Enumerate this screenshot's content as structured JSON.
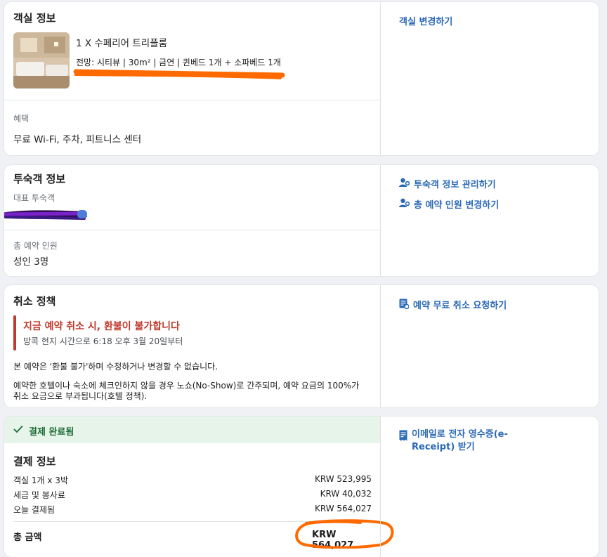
{
  "room": {
    "title": "객실 정보",
    "room_name": "1 X 수페리어 트리플룸",
    "details": "전망: 시티뷰 | 30m² | 금연 | 퀸베드 1개 + 소파베드 1개",
    "benefits_label": "혜택",
    "benefits_value": "무료 Wi-Fi, 주차, 피트니스 센터",
    "change_link": "객실 변경하기"
  },
  "guest": {
    "title": "투숙객 정보",
    "main_guest_label": "대표 투숙객",
    "total_label": "총 예약 인원",
    "total_value": "성인 3명",
    "manage_link": "투숙객 정보 관리하기",
    "change_count_link": "총 예약 인원 변경하기"
  },
  "cancel": {
    "title": "취소 정책",
    "warning": "지금 예약 취소 시, 환불이 불가합니다",
    "since": "방콕 현지 시간으로 6:18 오후 3월 20일부터",
    "note1": "본 예약은 '환불 불가'하며 수정하거나 변경할 수 없습니다.",
    "note2_line1": "예약한 호텔이나 숙소에 체크인하지 않을 경우 노쇼(No-Show)로 간주되며, 예약 요금의 100%가",
    "note2_line2": "취소 요금으로 부과됩니다(호텔 정책).",
    "request_link": "예약 무료 취소 요청하기"
  },
  "payment": {
    "status": "결제 완료됨",
    "title": "결제 정보",
    "rows": [
      {
        "label": "객실 1개 x 3박",
        "value": "KRW 523,995"
      },
      {
        "label": "세금 및 봉사료",
        "value": "KRW 40,032"
      },
      {
        "label": "오늘 결제됨",
        "value": "KRW 564,027"
      }
    ],
    "total_label": "총 금액",
    "total_value": "KRW 564,027",
    "receipt_link_line1": "이메일로 전자 영수증(e-",
    "receipt_link_line2": "Receipt) 받기"
  },
  "colors": {
    "link": "#2a69b6",
    "warning": "#c0392b",
    "success_bg": "#e6f4ea",
    "success_text": "#1e6b36",
    "annotation_orange": "#ff6a00",
    "redaction_purple": "#4b1c8a"
  }
}
